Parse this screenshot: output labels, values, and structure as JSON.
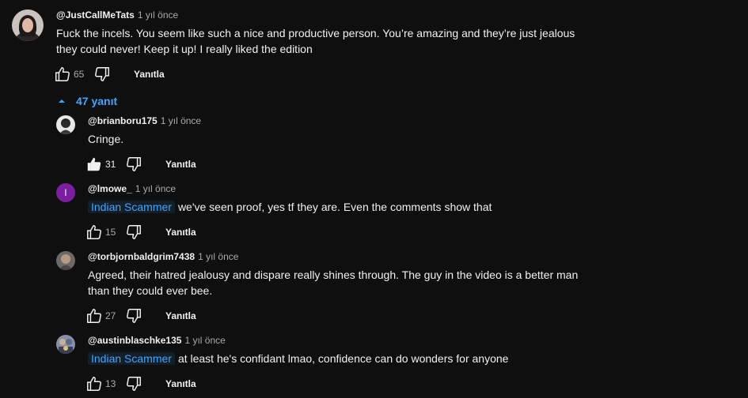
{
  "top_comment": {
    "author": "@JustCallMeTats",
    "time": "1 yıl önce",
    "text": "Fuck the incels. You seem like such a nice and productive person. You’re amazing and they’re just jealous\nthey could never! Keep it up! I really liked the edition",
    "likes": "65",
    "reply_label": "Yanıtla"
  },
  "replies_toggle": {
    "label": "47 yanıt",
    "icon": "caret-up-icon"
  },
  "replies": [
    {
      "author": "@brianboru175",
      "time": "1 yıl önce",
      "mention": "",
      "text": "Cringe.",
      "likes": "31",
      "liked": true,
      "reply_label": "Yanıtla"
    },
    {
      "author": "@lmowe_",
      "time": "1 yıl önce",
      "mention": "Indian Scammer",
      "text": "we've seen proof, yes tf they are. Even the comments show that",
      "likes": "15",
      "liked": false,
      "reply_label": "Yanıtla",
      "avatar_letter": "l"
    },
    {
      "author": "@torbjornbaldgrim7438",
      "time": "1 yıl önce",
      "mention": "",
      "text": "Agreed, their hatred jealousy and dispare really shines through. The guy in the video is a better man\nthan they could ever bee.",
      "likes": "27",
      "liked": false,
      "reply_label": "Yanıtla"
    },
    {
      "author": "@austinblaschke135",
      "time": "1 yıl önce",
      "mention": "Indian Scammer",
      "text": "at least he's confidant lmao, confidence can do wonders for anyone",
      "likes": "13",
      "liked": false,
      "reply_label": "Yanıtla"
    }
  ],
  "colors": {
    "background": "#0f0f0f",
    "text": "#f1f1f1",
    "secondary": "#aaaaaa",
    "link": "#3ea6ff",
    "avatar_purple": "#7b1fa2"
  }
}
